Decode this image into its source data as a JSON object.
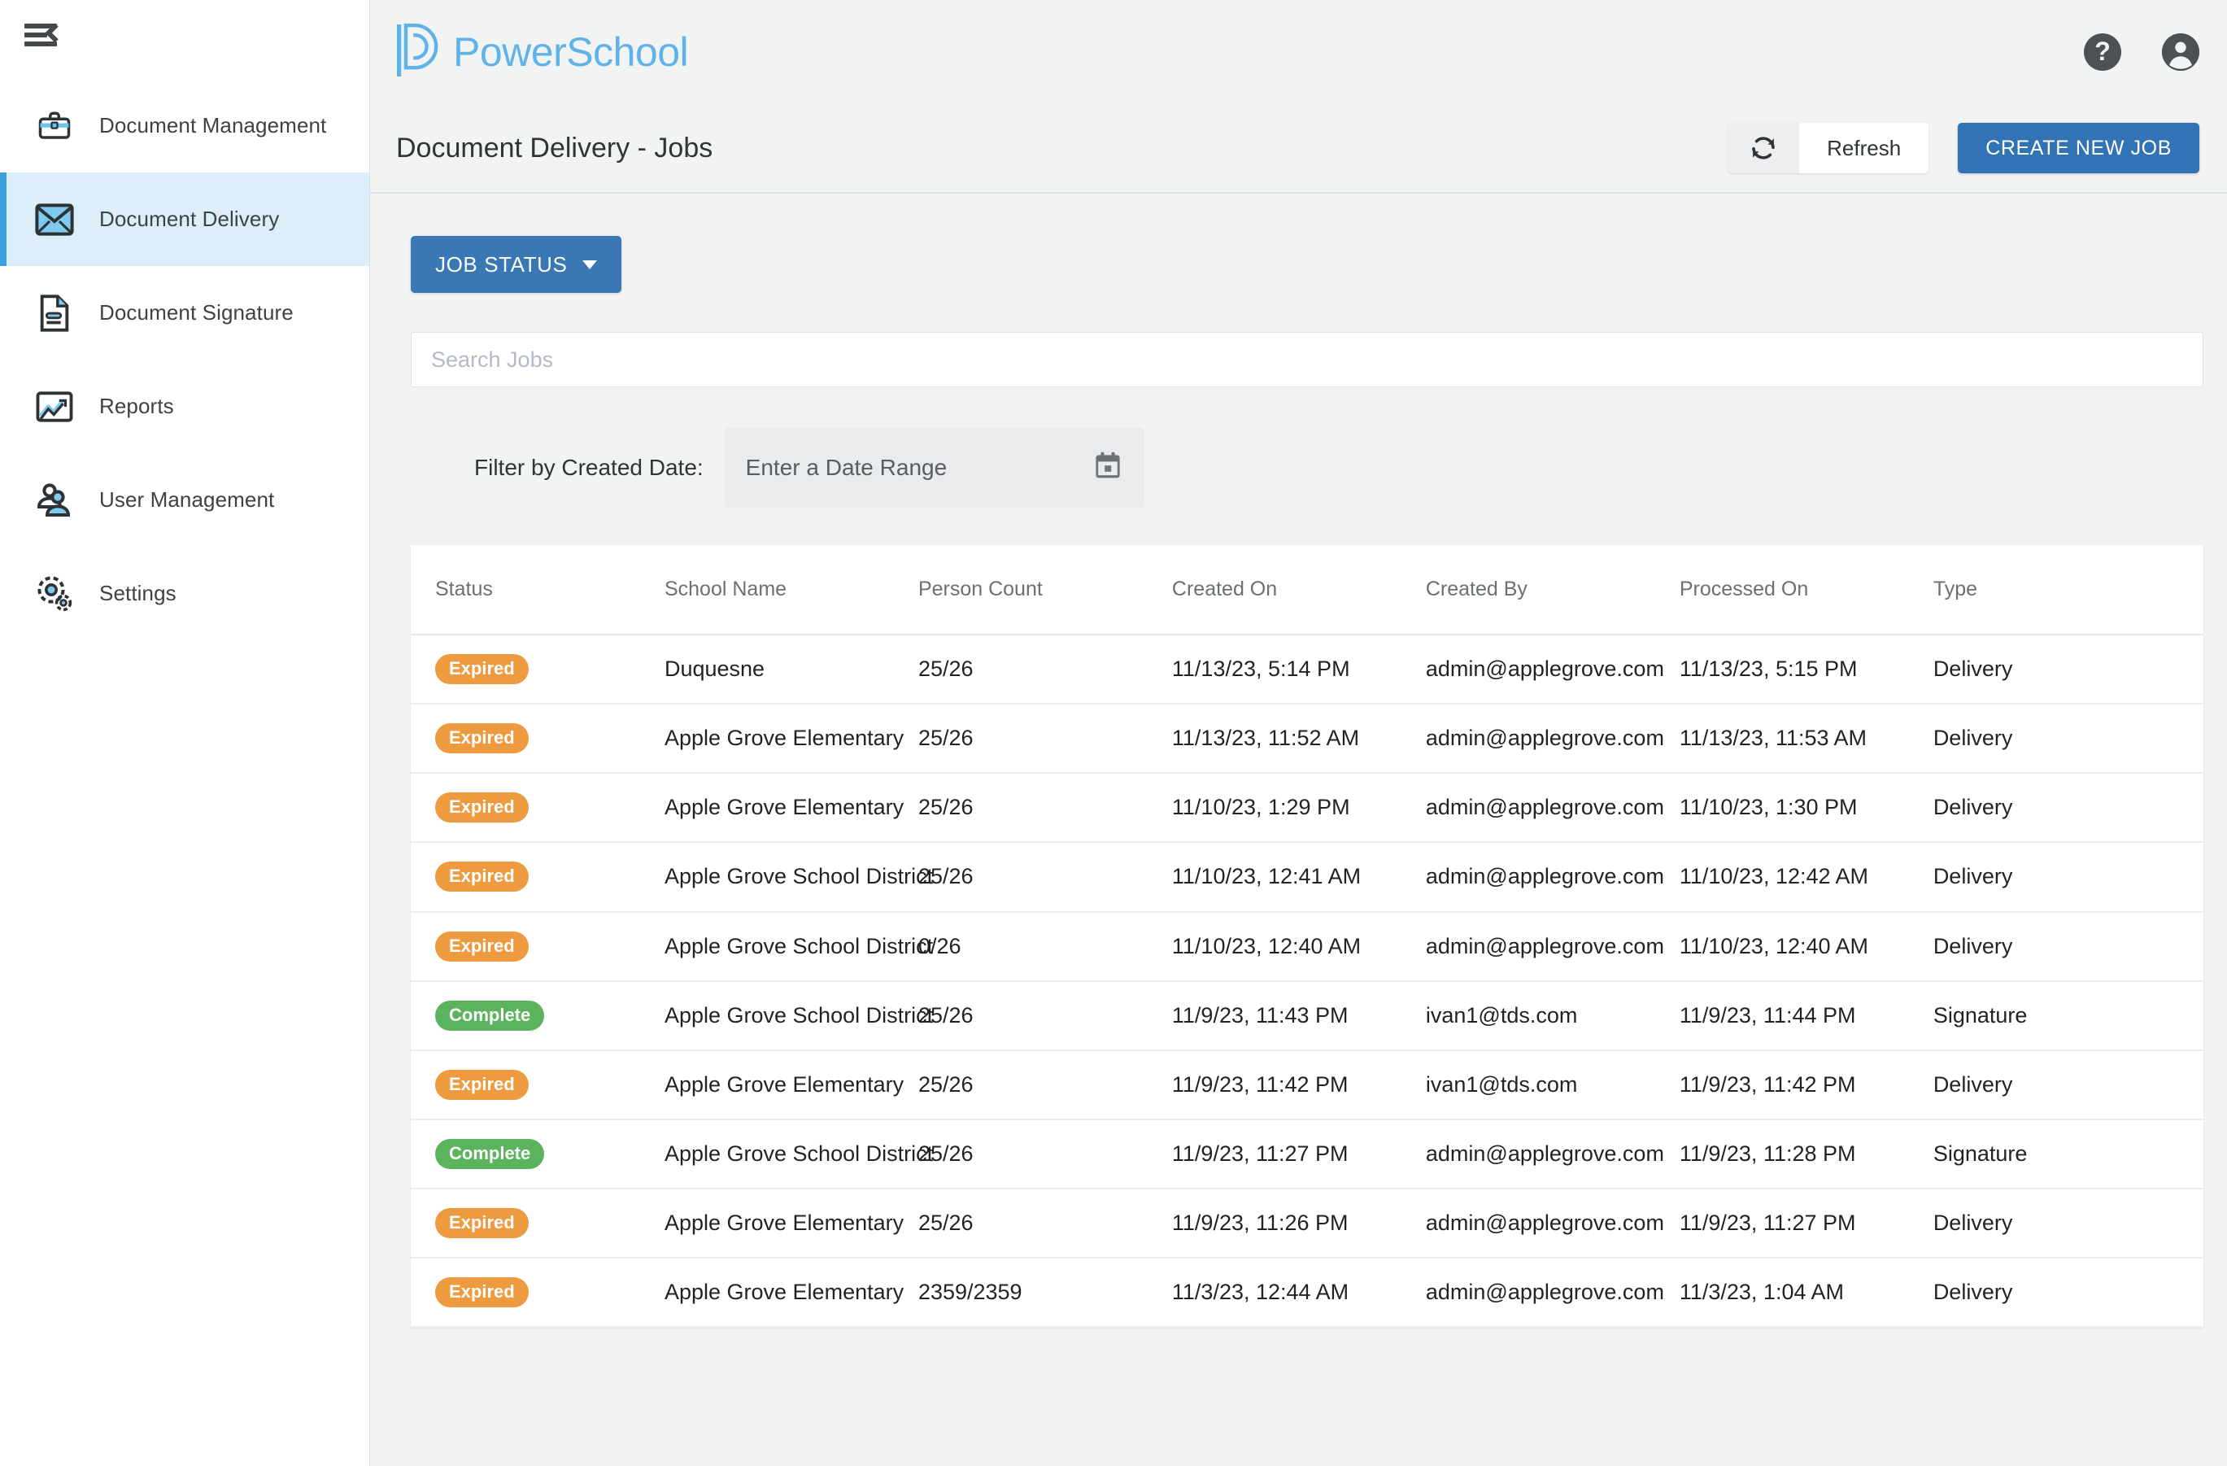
{
  "brand": {
    "name": "PowerSchool",
    "logo_icon": "powerschool-p-logo",
    "color": "#5fb3ea"
  },
  "header": {
    "collapse_icon": "menu-collapse-icon",
    "help_icon": "help-circle-icon",
    "account_icon": "account-circle-icon"
  },
  "sidebar": {
    "items": [
      {
        "label": "Document Management",
        "icon": "briefcase-icon",
        "active": false
      },
      {
        "label": "Document Delivery",
        "icon": "envelope-icon",
        "active": true
      },
      {
        "label": "Document Signature",
        "icon": "document-signature-icon",
        "active": false
      },
      {
        "label": "Reports",
        "icon": "chart-image-icon",
        "active": false
      },
      {
        "label": "User Management",
        "icon": "users-icon",
        "active": false
      },
      {
        "label": "Settings",
        "icon": "gears-icon",
        "active": false
      }
    ]
  },
  "titlebar": {
    "title": "Document Delivery - Jobs",
    "refresh_label": "Refresh",
    "refresh_icon": "sync-refresh-icon",
    "create_label": "CREATE NEW JOB"
  },
  "filters": {
    "job_status_label": "JOB STATUS",
    "search_placeholder": "Search Jobs",
    "search_value": "",
    "date_filter_label": "Filter by Created Date:",
    "date_placeholder": "Enter a Date Range",
    "calendar_icon": "calendar-icon"
  },
  "table": {
    "columns": [
      "Status",
      "School Name",
      "Person Count",
      "Created On",
      "Created By",
      "Processed On",
      "Type"
    ],
    "rows": [
      {
        "status": "Expired",
        "status_kind": "expired",
        "school": "Duquesne",
        "count": "25/26",
        "created_on": "11/13/23, 5:14 PM",
        "created_by": "admin@applegrove.com",
        "processed_on": "11/13/23, 5:15 PM",
        "type": "Delivery"
      },
      {
        "status": "Expired",
        "status_kind": "expired",
        "school": "Apple Grove Elementary",
        "count": "25/26",
        "created_on": "11/13/23, 11:52 AM",
        "created_by": "admin@applegrove.com",
        "processed_on": "11/13/23, 11:53 AM",
        "type": "Delivery"
      },
      {
        "status": "Expired",
        "status_kind": "expired",
        "school": "Apple Grove Elementary",
        "count": "25/26",
        "created_on": "11/10/23, 1:29 PM",
        "created_by": "admin@applegrove.com",
        "processed_on": "11/10/23, 1:30 PM",
        "type": "Delivery"
      },
      {
        "status": "Expired",
        "status_kind": "expired",
        "school": "Apple Grove School District",
        "count": "25/26",
        "created_on": "11/10/23, 12:41 AM",
        "created_by": "admin@applegrove.com",
        "processed_on": "11/10/23, 12:42 AM",
        "type": "Delivery"
      },
      {
        "status": "Expired",
        "status_kind": "expired",
        "school": "Apple Grove School District",
        "count": "0/26",
        "created_on": "11/10/23, 12:40 AM",
        "created_by": "admin@applegrove.com",
        "processed_on": "11/10/23, 12:40 AM",
        "type": "Delivery"
      },
      {
        "status": "Complete",
        "status_kind": "complete",
        "school": "Apple Grove School District",
        "count": "25/26",
        "created_on": "11/9/23, 11:43 PM",
        "created_by": "ivan1@tds.com",
        "processed_on": "11/9/23, 11:44 PM",
        "type": "Signature"
      },
      {
        "status": "Expired",
        "status_kind": "expired",
        "school": "Apple Grove Elementary",
        "count": "25/26",
        "created_on": "11/9/23, 11:42 PM",
        "created_by": "ivan1@tds.com",
        "processed_on": "11/9/23, 11:42 PM",
        "type": "Delivery"
      },
      {
        "status": "Complete",
        "status_kind": "complete",
        "school": "Apple Grove School District",
        "count": "25/26",
        "created_on": "11/9/23, 11:27 PM",
        "created_by": "admin@applegrove.com",
        "processed_on": "11/9/23, 11:28 PM",
        "type": "Signature"
      },
      {
        "status": "Expired",
        "status_kind": "expired",
        "school": "Apple Grove Elementary",
        "count": "25/26",
        "created_on": "11/9/23, 11:26 PM",
        "created_by": "admin@applegrove.com",
        "processed_on": "11/9/23, 11:27 PM",
        "type": "Delivery"
      },
      {
        "status": "Expired",
        "status_kind": "expired",
        "school": "Apple Grove Elementary",
        "count": "2359/2359",
        "created_on": "11/3/23, 12:44 AM",
        "created_by": "admin@applegrove.com",
        "processed_on": "11/3/23, 1:04 AM",
        "type": "Delivery"
      }
    ]
  },
  "colors": {
    "accent_blue": "#3273b5",
    "brand_blue": "#5fb3ea",
    "expired_orange": "#ee9a3e",
    "complete_green": "#5cb35e",
    "active_nav_bg": "#ddeefb"
  }
}
